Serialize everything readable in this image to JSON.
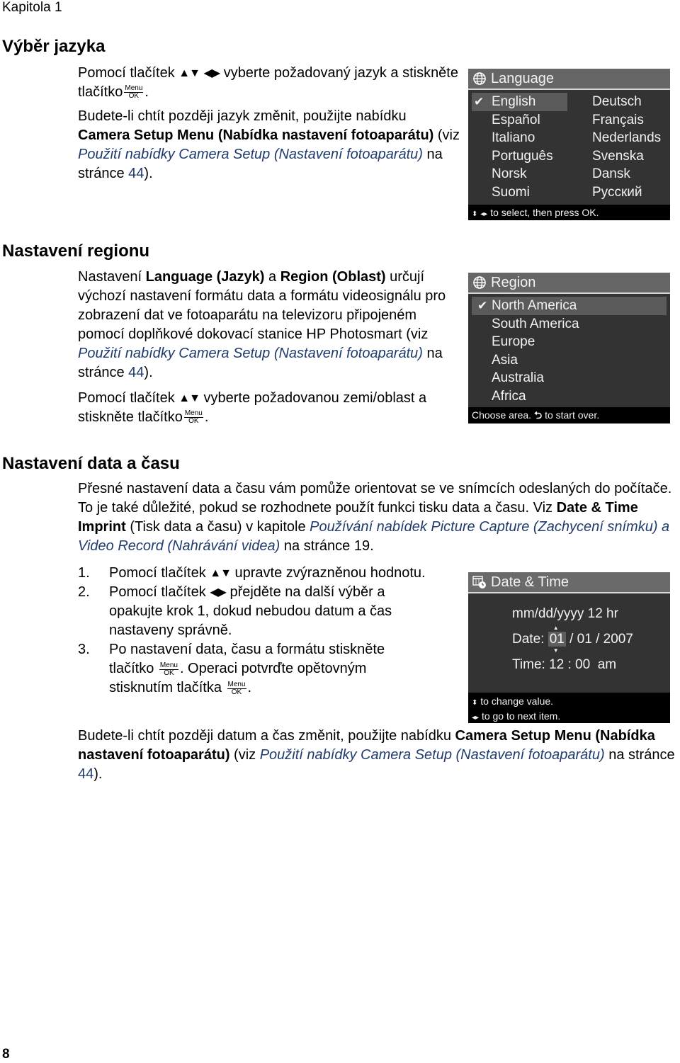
{
  "header": {
    "chapter": "Kapitola 1"
  },
  "section1": {
    "heading": "Výběr jazyka",
    "p1_a": "Pomocí tlačítek",
    "p1_b": "vyberte požadovaný jazyk a",
    "p1_c": "stiskněte tlačítko",
    "p1_d": ".",
    "p2_a": "Budete-li chtít později jazyk změnit, použijte nabídku",
    "p2_bold": "Camera Setup Menu (Nabídka nastavení fotoaparátu)",
    "p2_b": " (viz ",
    "p2_link": "Použití nabídky Camera Setup (Nastavení fotoaparátu)",
    "p2_c": " na stránce ",
    "p2_page": "44",
    "p2_d": ")."
  },
  "icons": {
    "up_down": "▲▼",
    "left_right": "◀▶",
    "menu_top": "Menu",
    "menu_bottom": "OK"
  },
  "language_screen": {
    "title": "Language",
    "icon": "globe-icon",
    "selected": "English",
    "left_column": [
      "English",
      "Español",
      "Italiano",
      "Português",
      "Norsk",
      "Suomi"
    ],
    "right_column": [
      "Deutsch",
      "Français",
      "Nederlands",
      "Svenska",
      "Dansk",
      "Русский"
    ],
    "footer": "to select, then press OK."
  },
  "section2": {
    "heading": "Nastavení regionu",
    "p1_a": "Nastavení ",
    "p1_bold1": "Language (Jazyk)",
    "p1_b": " a ",
    "p1_bold2": "Region (Oblast)",
    "p1_c": " určují výchozí nastavení formátu data a formátu videosignálu pro zobrazení dat ve fotoaparátu na televizoru připojeném pomocí doplňkové dokovací stanice HP Photosmart (viz ",
    "p1_link": "Použití nabídky Camera Setup (Nastavení fotoaparátu)",
    "p1_d": " na stránce ",
    "p1_page": "44",
    "p1_e": ").",
    "p2_a": "Pomocí tlačítek",
    "p2_b": "vyberte požadovanou zemi/oblast",
    "p2_c": "a stiskněte tlačítko",
    "p2_d": "."
  },
  "region_screen": {
    "title": "Region",
    "icon": "globe-icon",
    "selected": "North America",
    "items": [
      "North America",
      "South America",
      "Europe",
      "Asia",
      "Australia",
      "Africa"
    ],
    "footer_a": "Choose area.",
    "footer_b": "to start over."
  },
  "section3": {
    "heading": "Nastavení data a času",
    "intro_a": "Přesné nastavení data a času vám pomůže orientovat se ve snímcích odeslaných do počítače. To je také důležité, pokud se rozhodnete použít funkci tisku data a času. Viz ",
    "intro_bold": "Date & Time Imprint",
    "intro_b": " (Tisk data a času) v kapitole ",
    "intro_link": "Používání nabídek Picture Capture (Zachycení snímku) a Video Record (Nahrávání videa)",
    "intro_c": " na stránce 19.",
    "steps": [
      {
        "num": "1.",
        "a": "Pomocí tlačítek",
        "b": "upravte zvýrazněnou hodnotu."
      },
      {
        "num": "2.",
        "a": "Pomocí tlačítek",
        "b": "přejděte na další výběr a opakujte krok 1, dokud nebudou datum a čas nastaveny správně."
      },
      {
        "num": "3.",
        "a": "Po nastavení data, času a formátu stiskněte tlačítko",
        "b": ". Operaci potvrďte opětovným stisknutím tlačítka",
        "c": "."
      }
    ],
    "outro_a": "Budete-li chtít později datum a čas změnit, použijte nabídku ",
    "outro_bold": "Camera Setup Menu (Nabídka nastavení fotoaparátu)",
    "outro_b": " (viz ",
    "outro_link": "Použití nabídky Camera Setup (Nastavení fotoaparátu)",
    "outro_c": " na stránce ",
    "outro_page": "44",
    "outro_d": ")."
  },
  "datetime_screen": {
    "title": "Date & Time",
    "icon": "calendar-clock-icon",
    "format_line": "mm/dd/yyyy  12 hr",
    "date_label": "Date:",
    "date_month": "01",
    "date_rest": "/ 01 / 2007",
    "time_label": "Time:",
    "time_value": "12 : 00  am",
    "footer_line1": "to change value.",
    "footer_line2": "to go to next item."
  },
  "footer": {
    "page_number": "8"
  }
}
